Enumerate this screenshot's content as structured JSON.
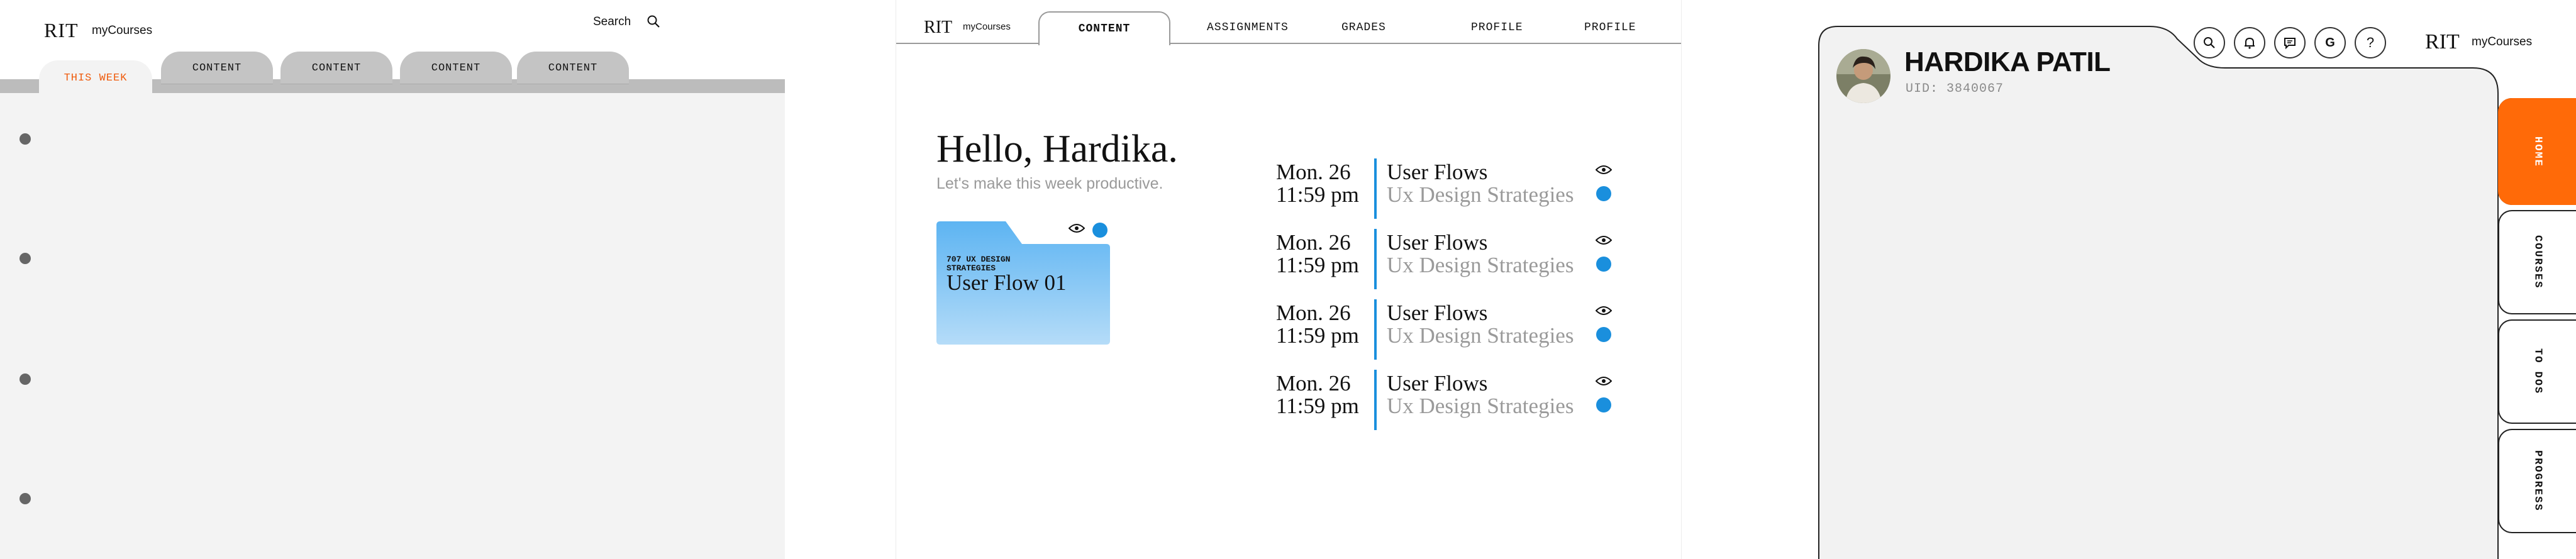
{
  "panel1": {
    "brand": {
      "rit": "RIT",
      "app": "myCourses"
    },
    "search_label": "Search",
    "tabs": [
      {
        "label": "THIS WEEK",
        "active": true
      },
      {
        "label": "CONTENT"
      },
      {
        "label": "CONTENT"
      },
      {
        "label": "CONTENT"
      },
      {
        "label": "CONTENT"
      }
    ],
    "accent": "#ef5b0c"
  },
  "panel2": {
    "brand": {
      "rit": "RIT",
      "app": "myCourses"
    },
    "tabs": [
      {
        "label": "CONTENT",
        "active": true
      },
      {
        "label": "ASSIGNMENTS"
      },
      {
        "label": "GRADES"
      },
      {
        "label": "PROFILE"
      },
      {
        "label": "PROFILE"
      }
    ],
    "greeting": "Hello, Hardika.",
    "subtitle": "Let's make this week productive.",
    "folder": {
      "course": "707 UX DESIGN STRATEGIES",
      "name": "User Flow 01"
    },
    "deadlines": [
      {
        "date": "Mon. 26",
        "time": "11:59 pm",
        "title": "User Flows",
        "course": "Ux Design Strategies"
      },
      {
        "date": "Mon. 26",
        "time": "11:59 pm",
        "title": "User Flows",
        "course": "Ux Design Strategies"
      },
      {
        "date": "Mon. 26",
        "time": "11:59 pm",
        "title": "User Flows",
        "course": "Ux Design Strategies"
      },
      {
        "date": "Mon. 26",
        "time": "11:59 pm",
        "title": "User Flows",
        "course": "Ux Design Strategies"
      }
    ],
    "accent": "#1a8fdd"
  },
  "panel3": {
    "brand": {
      "rit": "RIT",
      "app": "myCourses"
    },
    "user": {
      "name": "HARDIKA PATIL",
      "uid": "UID: 3840067"
    },
    "toolbar_icons": [
      "search-icon",
      "bell-icon",
      "chat-icon",
      "google-icon",
      "help-icon"
    ],
    "help_glyph": "?",
    "google_glyph": "G",
    "side_tabs": [
      {
        "label": "HOME",
        "active": true
      },
      {
        "label": "COURSES"
      },
      {
        "label": "TO DOS"
      },
      {
        "label": "PROGRESS"
      }
    ],
    "accent": "#ff6a08"
  }
}
